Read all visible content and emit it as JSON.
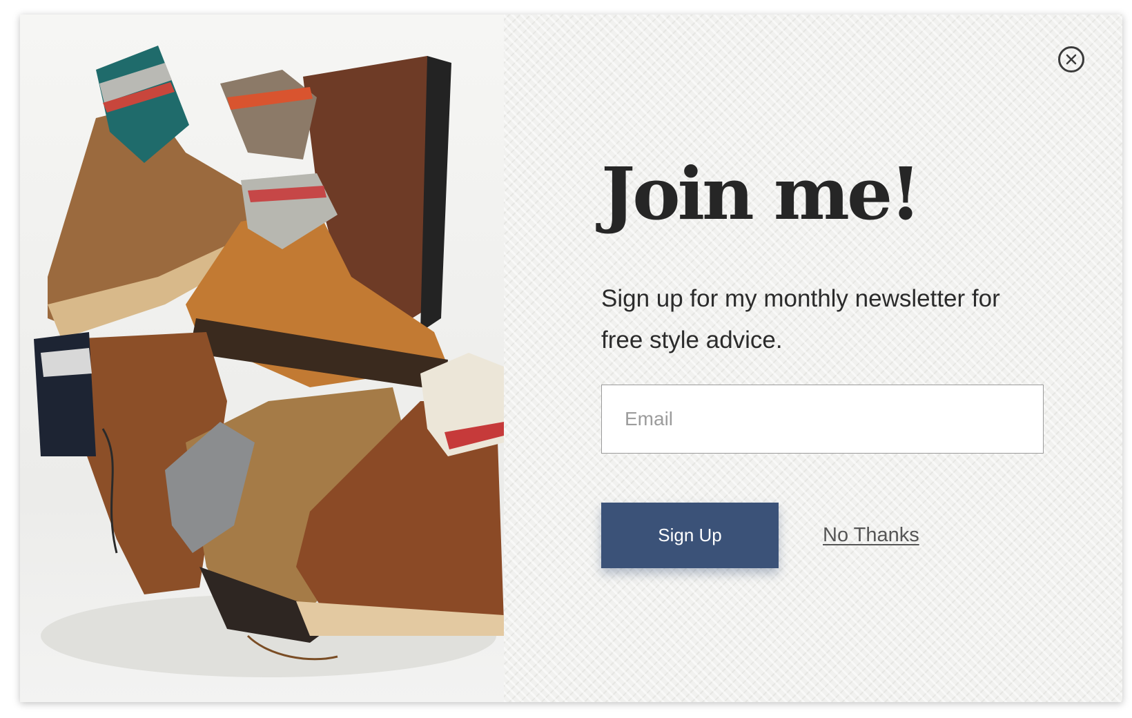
{
  "popup": {
    "headline": "Join me!",
    "subtext": "Sign up for my monthly newsletter for free style advice.",
    "email": {
      "placeholder": "Email",
      "value": ""
    },
    "signup_label": "Sign Up",
    "no_thanks_label": "No Thanks",
    "close_icon": "close-circle-x",
    "image_subject": "boots-and-socks-photo"
  },
  "colors": {
    "accent": "#3b5278",
    "headline": "#262626",
    "background": "#f1f1ef"
  }
}
